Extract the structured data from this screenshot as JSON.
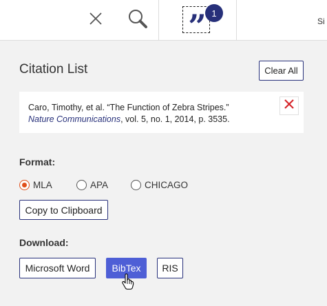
{
  "topbar": {
    "close_icon": "close-icon",
    "search_icon": "search-icon",
    "citation_glyph": "”",
    "citation_count": "1",
    "signin_label": "Si"
  },
  "panel": {
    "title": "Citation List",
    "clear_all_label": "Clear All"
  },
  "citation": {
    "line1": "Caro, Timothy, et al. “The Function of Zebra Stripes.”",
    "journal": "Nature Communications",
    "line2_rest": ", vol. 5, no. 1, 2014, p. 3535."
  },
  "format": {
    "label": "Format:",
    "options": [
      "MLA",
      "APA",
      "CHICAGO"
    ],
    "selected": "MLA",
    "copy_label": "Copy to Clipboard"
  },
  "download": {
    "label": "Download:",
    "buttons": [
      "Microsoft Word",
      "BibTex",
      "RIS"
    ],
    "hovered": "BibTex"
  },
  "colors": {
    "brand": "#27307a",
    "accent_button": "#4e5fd6",
    "radio_selected": "#e04e1a",
    "remove_x": "#d6262b"
  }
}
